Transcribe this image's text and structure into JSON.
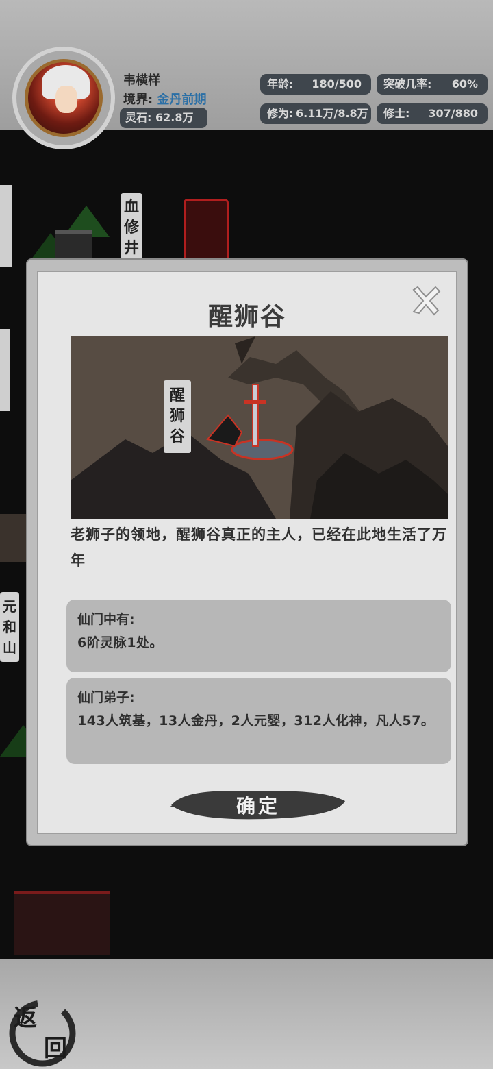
{
  "player": {
    "name": "韦横样",
    "realm_label": "境界:",
    "realm_value": "金丹前期",
    "spirit_stone": "灵石: 62.8万"
  },
  "stats": {
    "age_label": "年龄:",
    "age_value": "180/500",
    "breakthrough_label": "突破几率:",
    "breakthrough_value": "60%",
    "cultivation_label": "修为:",
    "cultivation_value": "6.11万/8.8万",
    "disciples_label": "修士:",
    "disciples_value": "307/880"
  },
  "map": {
    "labels": [
      {
        "text": "血修井"
      },
      {
        "text": "元和山"
      }
    ]
  },
  "modal": {
    "title": "醒狮谷",
    "scene_banner": "醒狮谷",
    "description": "老狮子的领地，醒狮谷真正的主人，已经在此地生活了万年",
    "sect_title": "仙门中有:",
    "sect_content": "6阶灵脉1处。",
    "disciples_title": "仙门弟子:",
    "disciples_content": "143人筑基，13人金丹，2人元婴，312人化神，凡人57。",
    "confirm_label": "确定"
  },
  "back_button": {
    "char1": "返",
    "char2": "回"
  },
  "colors": {
    "realm_accent": "#2a6fa6",
    "pill_bg": "#3f464d",
    "modal_bg": "#e6e6e6",
    "info_box_bg": "#b7b7b7",
    "tower_red": "#b01e1e"
  }
}
